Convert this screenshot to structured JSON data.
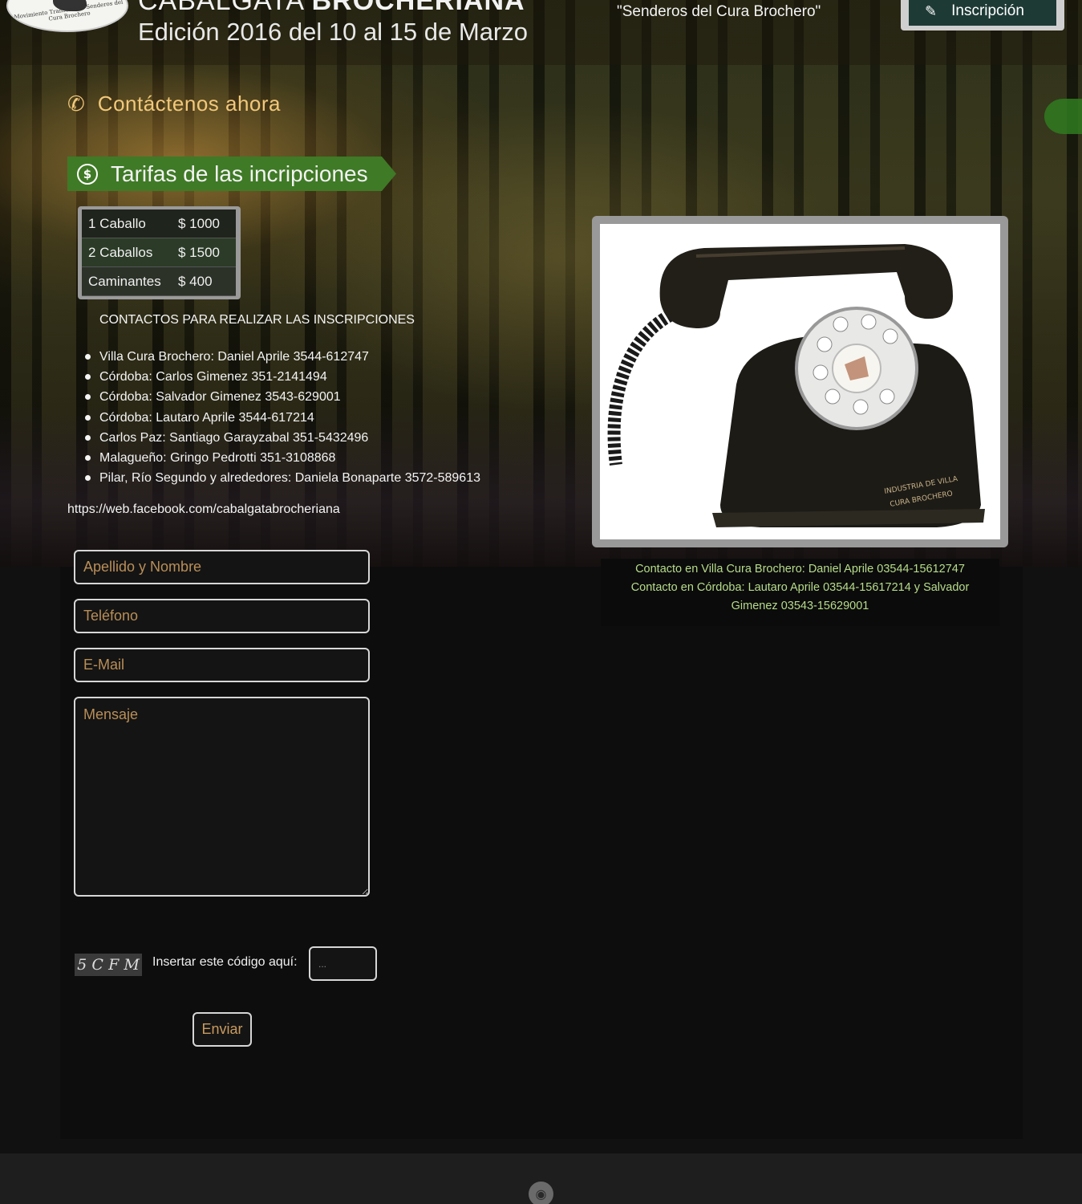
{
  "header": {
    "logo_text": "Movimiento Transerrano Senderos del Cura Brochero",
    "title_light": "CABALGATA ",
    "title_bold": "BROCHERIANA",
    "subtitle": "Edición 2016 del 10 al 15 de Marzo",
    "slogan": "\"Senderos del Cura Brochero\"",
    "inscripcion_button": "Inscripción"
  },
  "contact_now": {
    "label": "Contáctenos ahora",
    "icon": "phone-icon"
  },
  "tarifas": {
    "title": "Tarifas de las incripciones",
    "icon": "dollar-circle-icon",
    "rows": [
      {
        "name": "1 Caballo",
        "price": "$ 1000"
      },
      {
        "name": "2 Caballos",
        "price": "$ 1500"
      },
      {
        "name": "Caminantes",
        "price": "$ 400"
      }
    ]
  },
  "contacts": {
    "heading": "CONTACTOS PARA REALIZAR LAS INSCRIPCIONES",
    "items": [
      "Villa Cura Brochero: Daniel Aprile 3544-612747",
      "Córdoba: Carlos Gimenez 351-2141494",
      "Córdoba: Salvador Gimenez 3543-629001",
      "Córdoba: Lautaro Aprile 3544-617214",
      "Carlos Paz: Santiago Garayzabal 351-5432496",
      "Malagueño: Gringo Pedrotti 351-3108868",
      "Pilar, Río Segundo y alrededores: Daniela Bonaparte 3572-589613"
    ],
    "facebook": "https://web.facebook.com/cabalgatabrocheriana"
  },
  "photo": {
    "engraving_line1": "INDUSTRIA DE VILLA",
    "engraving_line2": "CURA BROCHERO",
    "caption_line1": "Contacto en Villa Cura Brochero: Daniel Aprile 03544-15612747",
    "caption_line2": "Contacto en Córdoba: Lautaro Aprile 03544-15617214 y Salvador",
    "caption_line3": "Gimenez 03543-15629001"
  },
  "form": {
    "name_placeholder": "Apellido y Nombre",
    "phone_placeholder": "Teléfono",
    "email_placeholder": "E-Mail",
    "message_placeholder": "Mensaje",
    "captcha_code": [
      "5",
      "C",
      "F",
      "M"
    ],
    "captcha_label": "Insertar este código aquí:",
    "captcha_placeholder": "...",
    "submit_label": "Enviar"
  },
  "footer": {
    "icon": "rss-icon"
  },
  "colors": {
    "accent_orange": "#f2c87a",
    "banner_green": "#3f7a26",
    "caption_green": "#b7dc8a"
  }
}
